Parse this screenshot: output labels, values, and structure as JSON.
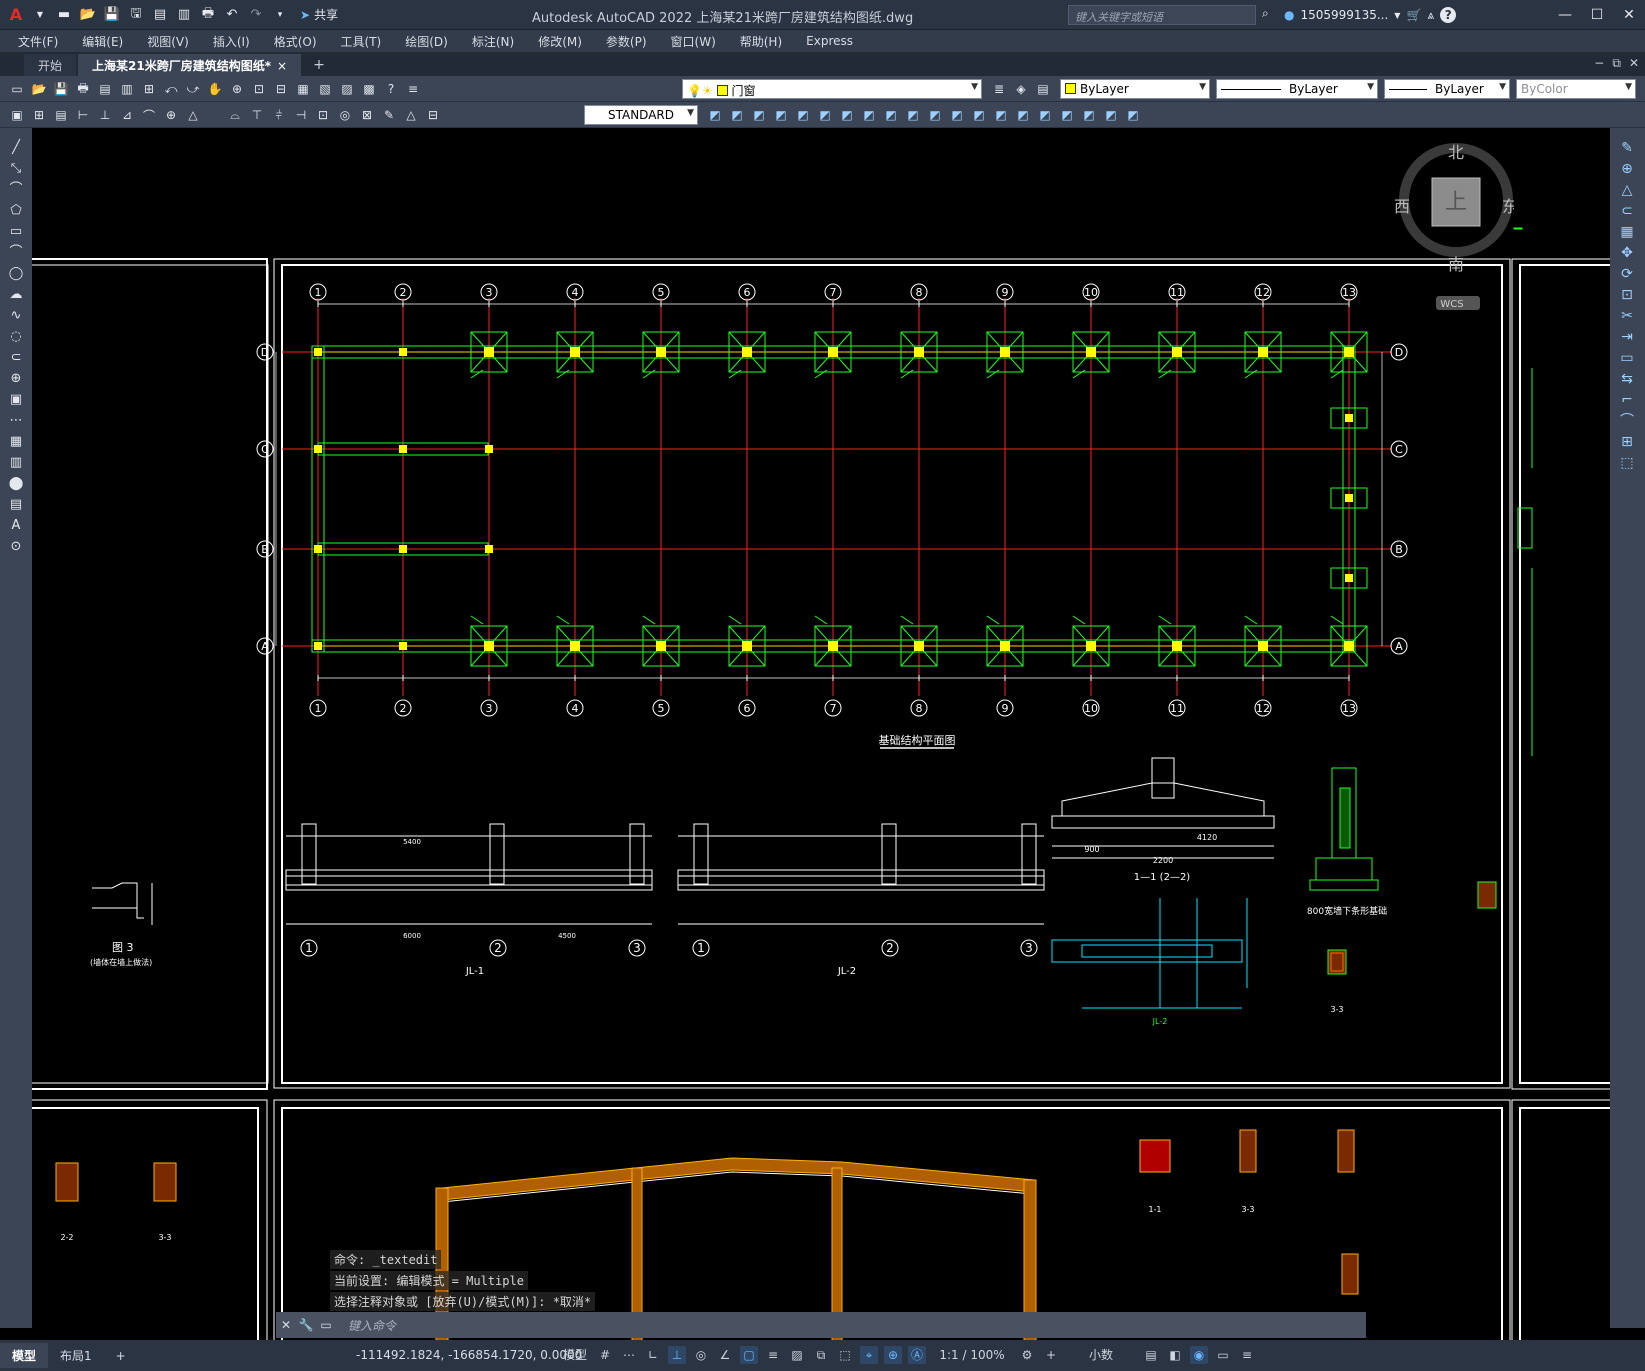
{
  "app": {
    "logo": "A",
    "share_label": "共享",
    "window_title": "Autodesk AutoCAD 2022    上海某21米跨厂房建筑结构图纸.dwg",
    "search_placeholder": "键入关键字或短语",
    "account": "1505999135...",
    "help": "?"
  },
  "menu": [
    "文件(F)",
    "编辑(E)",
    "视图(V)",
    "插入(I)",
    "格式(O)",
    "工具(T)",
    "绘图(D)",
    "标注(N)",
    "修改(M)",
    "参数(P)",
    "窗口(W)",
    "帮助(H)",
    "Express"
  ],
  "tabs": [
    {
      "label": "开始"
    },
    {
      "label": "上海某21米跨厂房建筑结构图纸*",
      "close": "×"
    }
  ],
  "toolbar": {
    "layer": "门窗",
    "color": "ByLayer",
    "linetype": "ByLayer",
    "lineweight": "ByLayer",
    "plotstyle": "ByColor",
    "textstyle": "STANDARD"
  },
  "viewcube": {
    "north": "北",
    "south": "南",
    "east": "东",
    "west": "西",
    "top": "上",
    "wcs": "WCS"
  },
  "drawing": {
    "axis_numbers": [
      "1",
      "2",
      "3",
      "4",
      "5",
      "6",
      "7",
      "8",
      "9",
      "10",
      "11",
      "12",
      "13"
    ],
    "axis_letters": [
      "D",
      "C",
      "B",
      "A"
    ],
    "plan_title": "基础结构平面图",
    "section_1": "JL-1",
    "section_2": "JL-2",
    "detail_3": "图 3",
    "detail_3_sub": "(墙体在墙上做法)",
    "sec_1_1": "1—1  (2—2)",
    "wall_detail": "800宽墙下条形基础",
    "sec_3_3": "3-3",
    "bottom_1_1": "1-1",
    "bottom_2_2": "2-2",
    "bottom_3_3": "3-3",
    "jl2": "JL-2",
    "dim_6000": "6000",
    "dim_4500": "4500",
    "dim_5400": "5400",
    "dim_2200": "2200",
    "dim_4120": "4120",
    "dim_900": "900"
  },
  "command": {
    "line1": "命令: _textedit",
    "line2": "当前设置: 编辑模式 = Multiple",
    "line3": "选择注释对象或 [放弃(U)/模式(M)]: *取消*",
    "placeholder": "键入命令"
  },
  "status": {
    "model_tab": "模型",
    "layout_tab": "布局1",
    "coords": "-111492.1824, -166854.1720, 0.0000",
    "mode": "模型",
    "scale": "1:1 / 100%",
    "units": "小数"
  }
}
